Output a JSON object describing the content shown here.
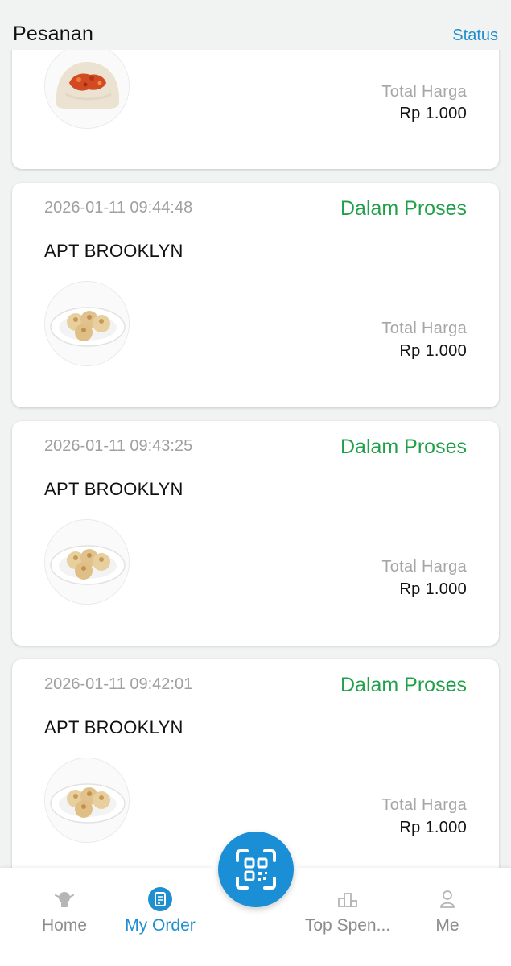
{
  "header": {
    "title": "Pesanan",
    "status_link": "Status"
  },
  "orders": [
    {
      "date": "",
      "status": "",
      "store": "",
      "total_label": "Total Harga",
      "total_value": "Rp 1.000",
      "item_image": "bun-pizza-icon"
    },
    {
      "date": "2026-01-11 09:44:48",
      "status": "Dalam Proses",
      "store": "APT BROOKLYN",
      "total_label": "Total Harga",
      "total_value": "Rp 1.000",
      "item_image": "dumplings-plate-icon"
    },
    {
      "date": "2026-01-11 09:43:25",
      "status": "Dalam Proses",
      "store": "APT BROOKLYN",
      "total_label": "Total Harga",
      "total_value": "Rp 1.000",
      "item_image": "dumplings-plate-icon"
    },
    {
      "date": "2026-01-11 09:42:01",
      "status": "Dalam Proses",
      "store": "APT BROOKLYN",
      "total_label": "Total Harga",
      "total_value": "Rp 1.000",
      "item_image": "dumplings-plate-icon"
    }
  ],
  "nav": {
    "items": [
      {
        "label": "Home",
        "icon": "home-icon",
        "active": false
      },
      {
        "label": "My Order",
        "icon": "order-list-icon",
        "active": true
      },
      {
        "label": "Top Spen...",
        "icon": "podium-icon",
        "active": false
      },
      {
        "label": "Me",
        "icon": "person-icon",
        "active": false
      }
    ],
    "scan_icon": "qr-scan-icon"
  },
  "colors": {
    "accent": "#1f8fd0",
    "status_green": "#21a04a",
    "background": "#f1f2f2",
    "muted_text": "#a0a0a0"
  }
}
